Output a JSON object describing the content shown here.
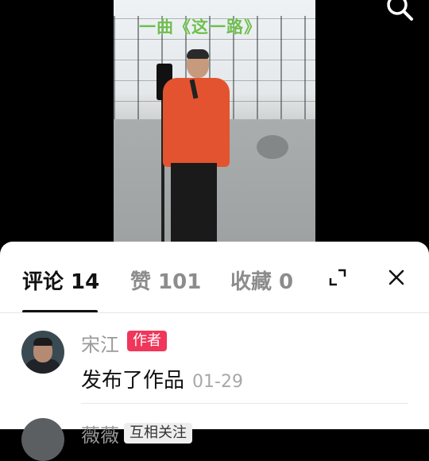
{
  "video": {
    "overlay_title": "一曲《这一路》"
  },
  "tabs": [
    {
      "label": "评论 14",
      "active": true
    },
    {
      "label": "赞 101",
      "active": false
    },
    {
      "label": "收藏 0",
      "active": false
    }
  ],
  "comments": [
    {
      "username": "宋江",
      "badge": "作者",
      "text": "发布了作品",
      "date": "01-29"
    },
    {
      "username": "薇薇",
      "badge": "互相关注"
    }
  ],
  "icons": {
    "search": "search-icon",
    "expand": "expand-icon",
    "close": "close-icon"
  },
  "colors": {
    "badge_author": "#f0365a",
    "overlay_title": "#6fbf4f"
  }
}
